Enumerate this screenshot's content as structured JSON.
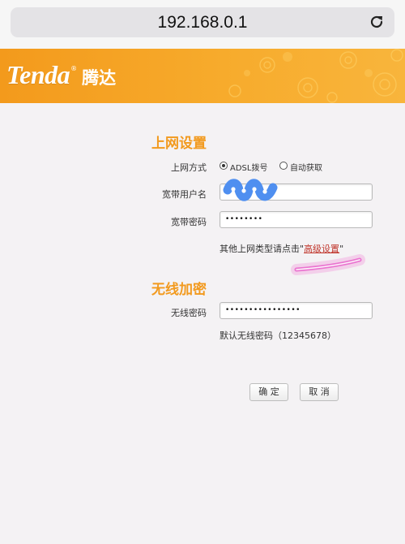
{
  "browser": {
    "url": "192.168.0.1",
    "reload_icon": "reload-icon"
  },
  "brand": {
    "logo_wordmark": "Tenda",
    "logo_chinese": "腾达",
    "registered_mark": "®",
    "header_color": "#f39a1c"
  },
  "internet_settings": {
    "title": "上网设置",
    "connection_type_label": "上网方式",
    "options": [
      {
        "label": "ADSL拨号",
        "selected": true
      },
      {
        "label": "自动获取",
        "selected": false
      }
    ],
    "username_label": "宽带用户名",
    "username_value": "",
    "password_label": "宽带密码",
    "password_value": "••••••••",
    "hint_prefix": "其他上网类型请点击\"",
    "hint_link": "高级设置",
    "hint_suffix": "\""
  },
  "wireless": {
    "title": "无线加密",
    "password_label": "无线密码",
    "password_value": "••••••••••••••••",
    "default_note": "默认无线密码（12345678）"
  },
  "actions": {
    "confirm_label": "确 定",
    "cancel_label": "取 消"
  },
  "colors": {
    "accent": "#f29a1e",
    "link": "#c0362c"
  }
}
